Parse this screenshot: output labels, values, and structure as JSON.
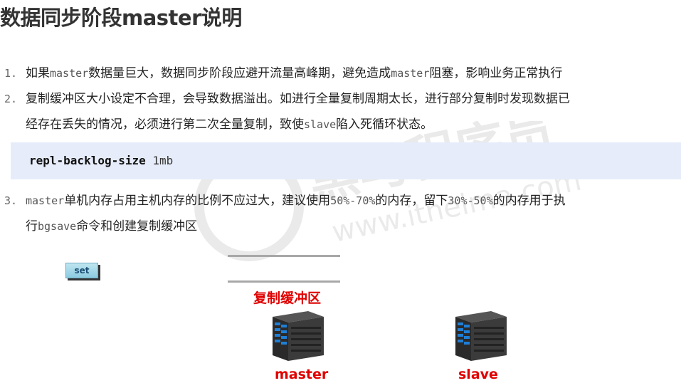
{
  "title": "数据同步阶段master说明",
  "items": [
    {
      "num": "1.",
      "parts": [
        "如果",
        "master",
        "数据量巨大，数据同步阶段应避开流量高峰期，避免造成",
        "master",
        "阻塞，影响业务正常执行"
      ]
    },
    {
      "num": "2.",
      "line1": "复制缓冲区大小设定不合理，会导致数据溢出。如进行全量复制周期太长，进行部分复制时发现数据已",
      "line2_parts": [
        "经存在丢失的情况，必须进行第二次全量复制，致使",
        "slave",
        "陷入死循环状态。"
      ]
    },
    {
      "num": "3.",
      "line1_parts": [
        "master",
        "单机内存占用主机内存的比例不应过大，建议使用",
        "50%-70%",
        "的内存，留下",
        "30%-50%",
        "的内存用于执"
      ],
      "line2_parts": [
        "行",
        "bgsave",
        "命令和创建复制缓冲区"
      ]
    }
  ],
  "code": {
    "key": "repl-backlog-size",
    "value": "1mb"
  },
  "diagram": {
    "set_label": "set",
    "buffer_label": "复制缓冲区",
    "master_label": "master",
    "slave_label": "slave"
  },
  "colors": {
    "label_red": "#e00000",
    "code_bg": "#e6ecfa"
  }
}
